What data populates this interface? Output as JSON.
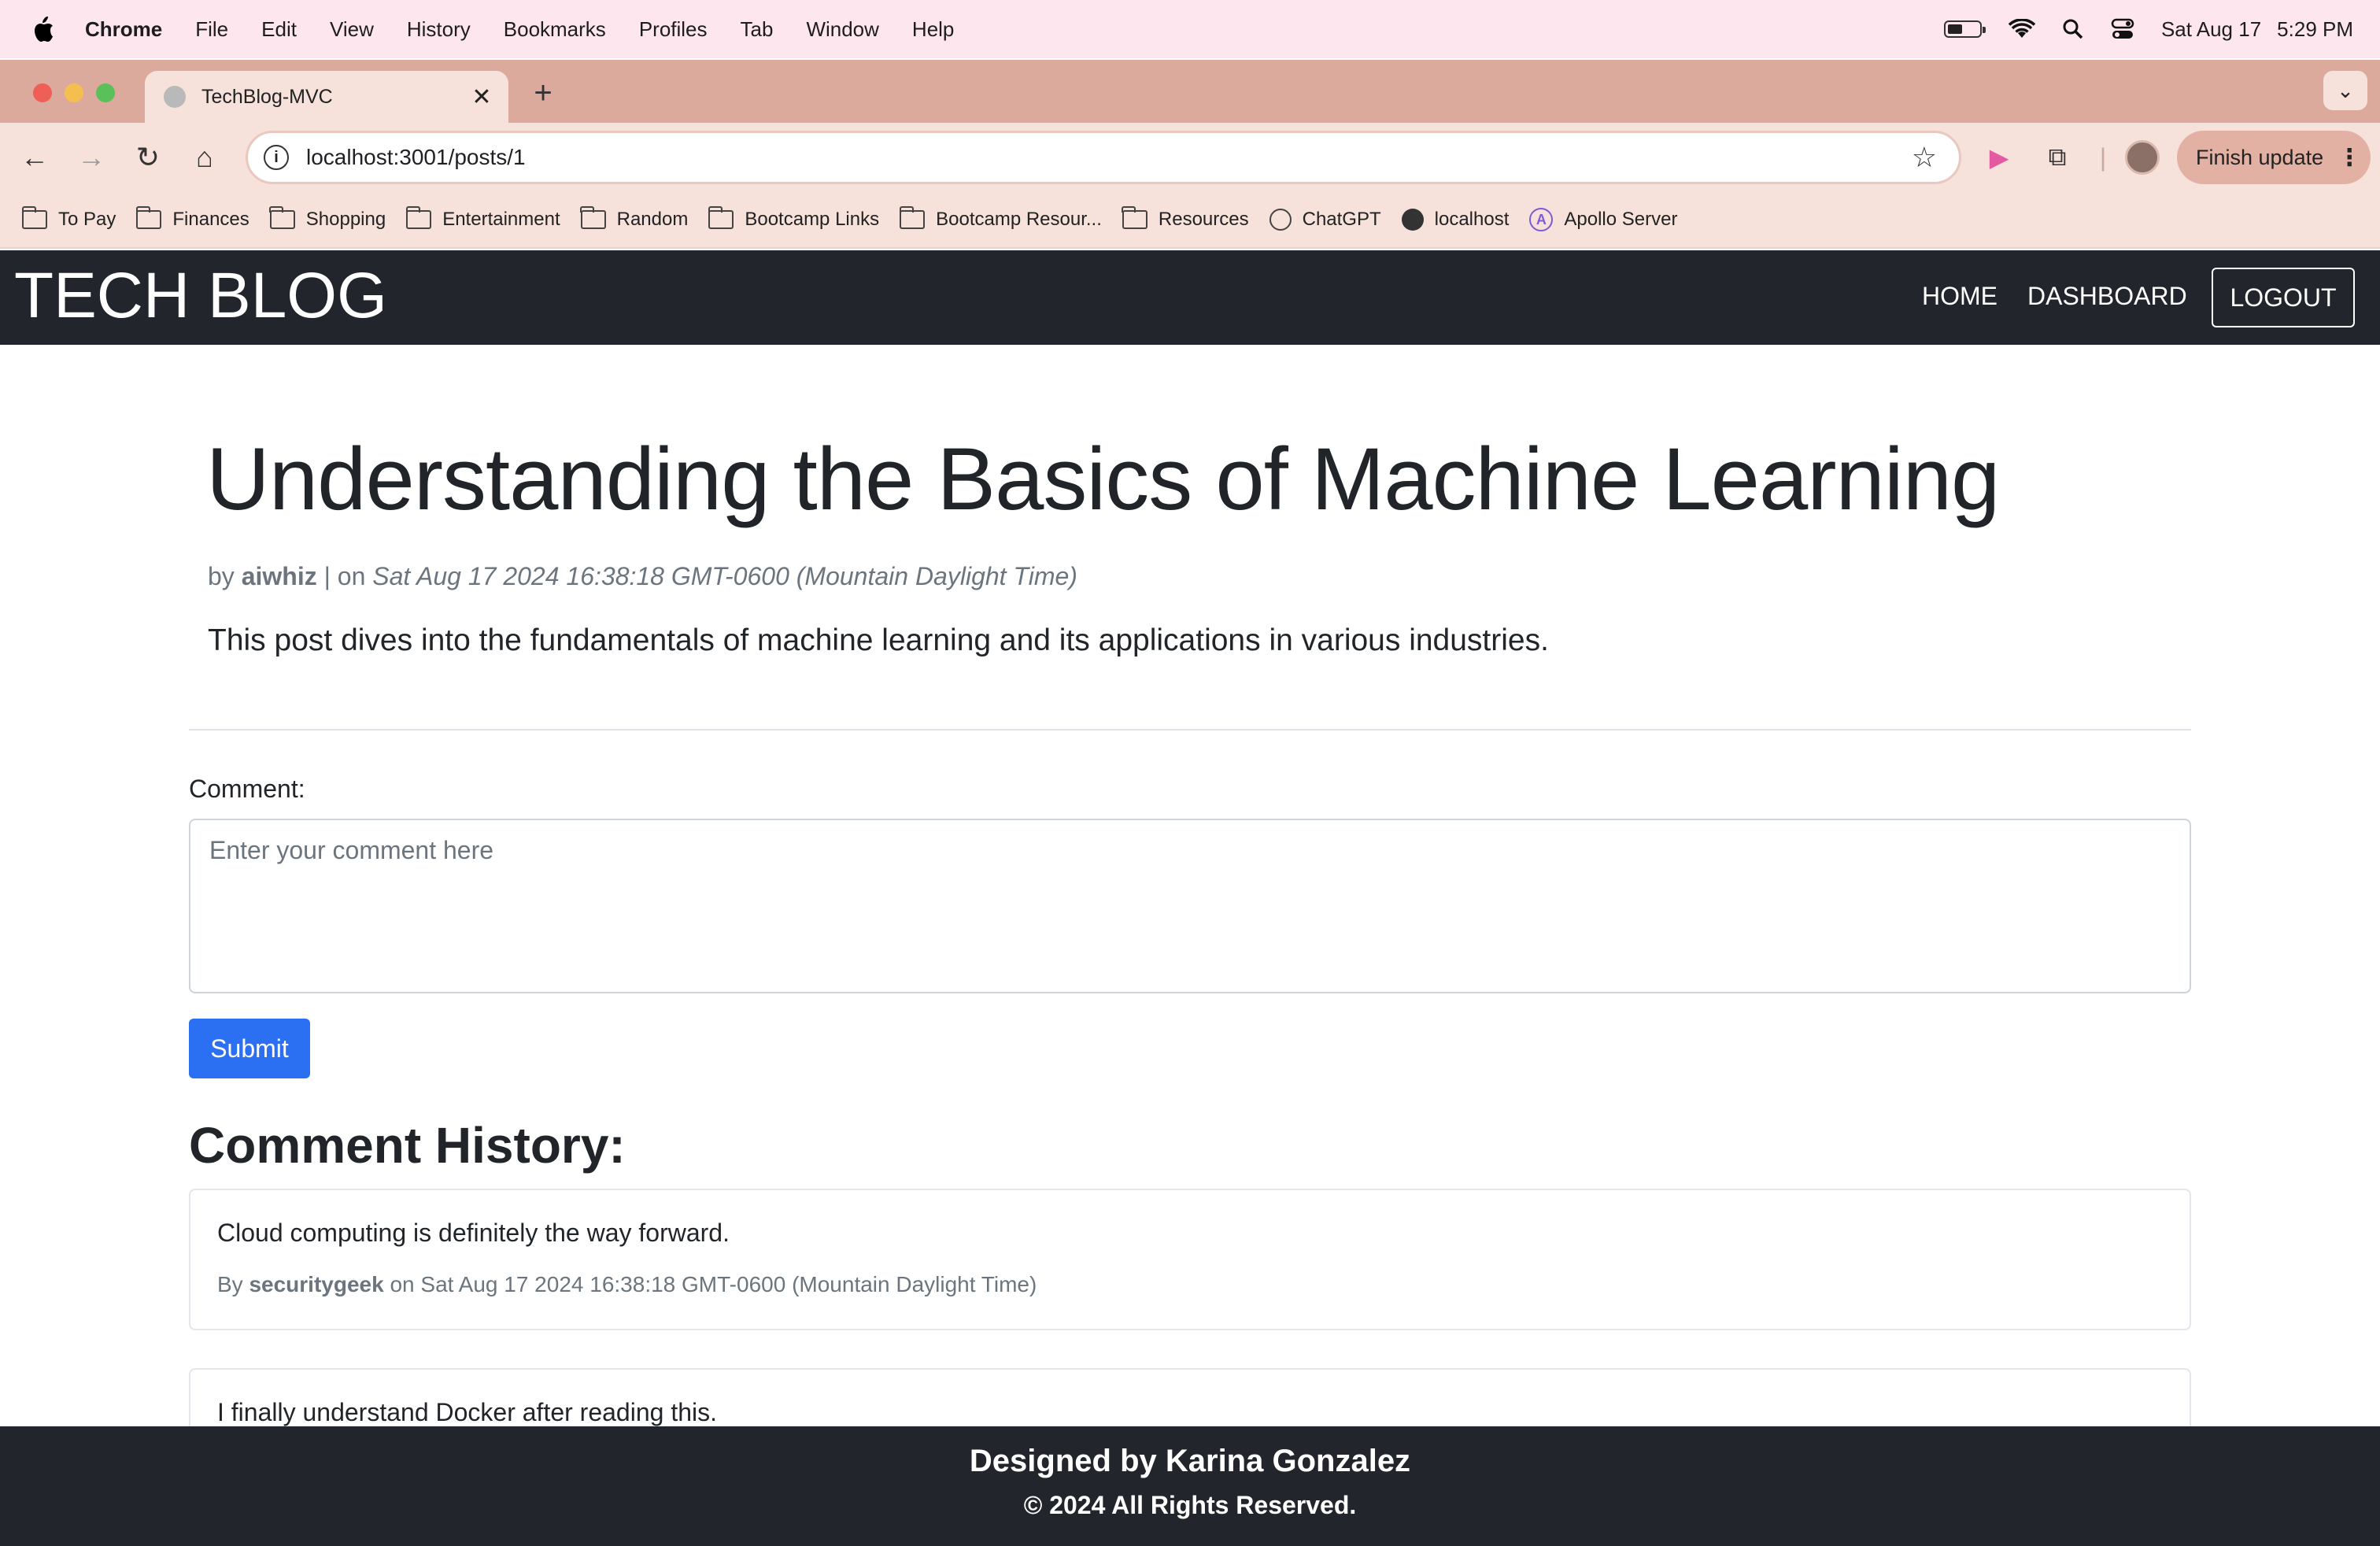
{
  "menubar": {
    "app": "Chrome",
    "items": [
      "File",
      "Edit",
      "View",
      "History",
      "Bookmarks",
      "Profiles",
      "Tab",
      "Window",
      "Help"
    ],
    "date": "Sat Aug 17",
    "time": "5:29 PM"
  },
  "browser": {
    "tab_title": "TechBlog-MVC",
    "url": "localhost:3001/posts/1",
    "finish_update": "Finish update",
    "bookmarks": [
      {
        "label": "To Pay",
        "icon": "folder-icon"
      },
      {
        "label": "Finances",
        "icon": "folder-icon"
      },
      {
        "label": "Shopping",
        "icon": "folder-icon"
      },
      {
        "label": "Entertainment",
        "icon": "folder-icon"
      },
      {
        "label": "Random",
        "icon": "folder-icon"
      },
      {
        "label": "Bootcamp Links",
        "icon": "folder-icon"
      },
      {
        "label": "Bootcamp Resour...",
        "icon": "folder-icon"
      },
      {
        "label": "Resources",
        "icon": "folder-icon"
      },
      {
        "label": "ChatGPT",
        "icon": "chatgpt-icon"
      },
      {
        "label": "localhost",
        "icon": "globe-icon"
      },
      {
        "label": "Apollo Server",
        "icon": "apollo-icon"
      }
    ]
  },
  "site": {
    "brand": "TECH BLOG",
    "nav": {
      "home": "HOME",
      "dashboard": "DASHBOARD",
      "logout": "LOGOUT"
    }
  },
  "post": {
    "title": "Understanding the Basics of Machine Learning",
    "by_prefix": "by",
    "author": "aiwhiz",
    "on_sep": "| on",
    "date": "Sat Aug 17 2024 16:38:18 GMT-0600 (Mountain Daylight Time)",
    "body": "This post dives into the fundamentals of machine learning and its applications in various industries."
  },
  "comment_form": {
    "label": "Comment:",
    "placeholder": "Enter your comment here",
    "submit": "Submit"
  },
  "comment_history": {
    "title": "Comment History:",
    "comments": [
      {
        "text": "Cloud computing is definitely the way forward.",
        "by_prefix": "By",
        "author": "securitygeek",
        "date": "on Sat Aug 17 2024 16:38:18 GMT-0600 (Mountain Daylight Time)"
      },
      {
        "text": "I finally understand Docker after reading this."
      }
    ]
  },
  "footer": {
    "designed_by": "Designed by Karina Gonzalez",
    "copyright": "© 2024 All Rights Reserved."
  },
  "colors": {
    "header_bg": "#22252b",
    "primary_button": "#2b6ff2",
    "menubar_bg": "#fde6ee",
    "chrome_frame": "#dcaa9c"
  }
}
